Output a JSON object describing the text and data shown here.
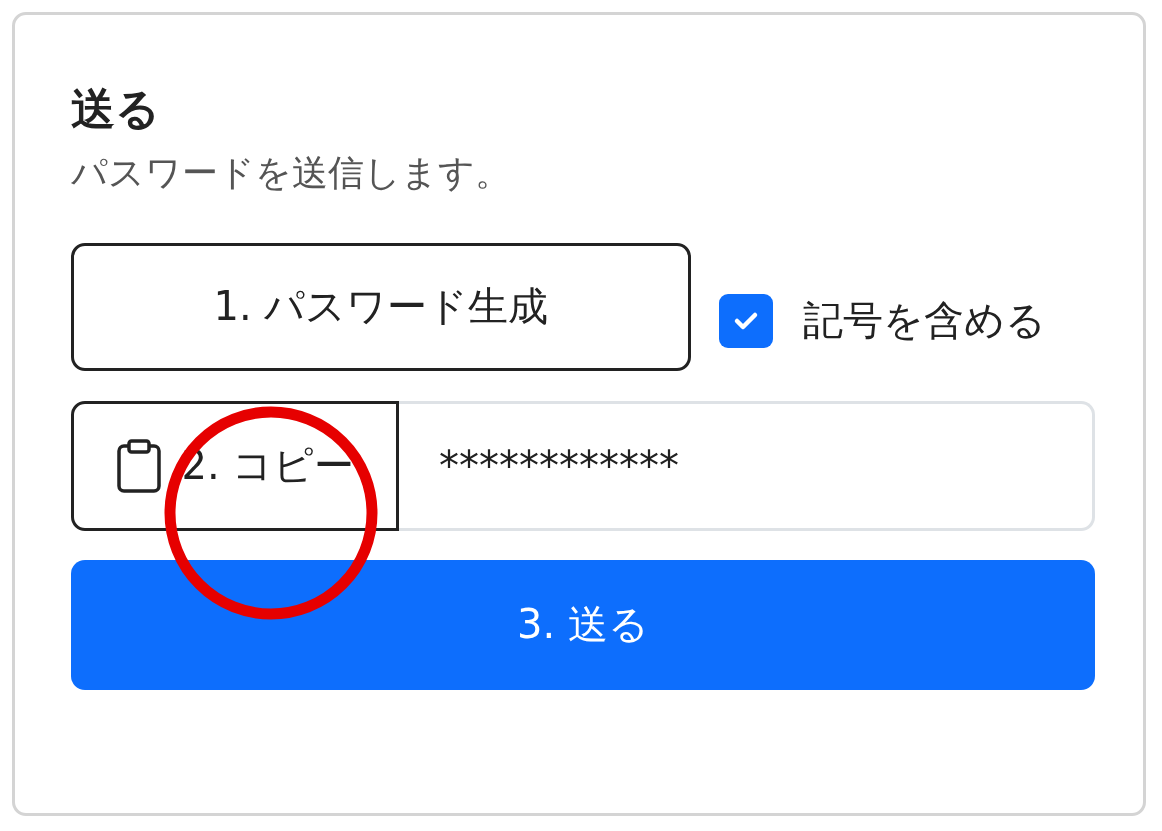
{
  "card": {
    "title": "送る",
    "subtitle": "パスワードを送信します。"
  },
  "generate_button": {
    "label": "1. パスワード生成"
  },
  "symbols_checkbox": {
    "label": "記号を含める",
    "checked": true
  },
  "copy_button": {
    "label": "2. コピー"
  },
  "password_field": {
    "value": "************"
  },
  "send_button": {
    "label": "3. 送る"
  }
}
